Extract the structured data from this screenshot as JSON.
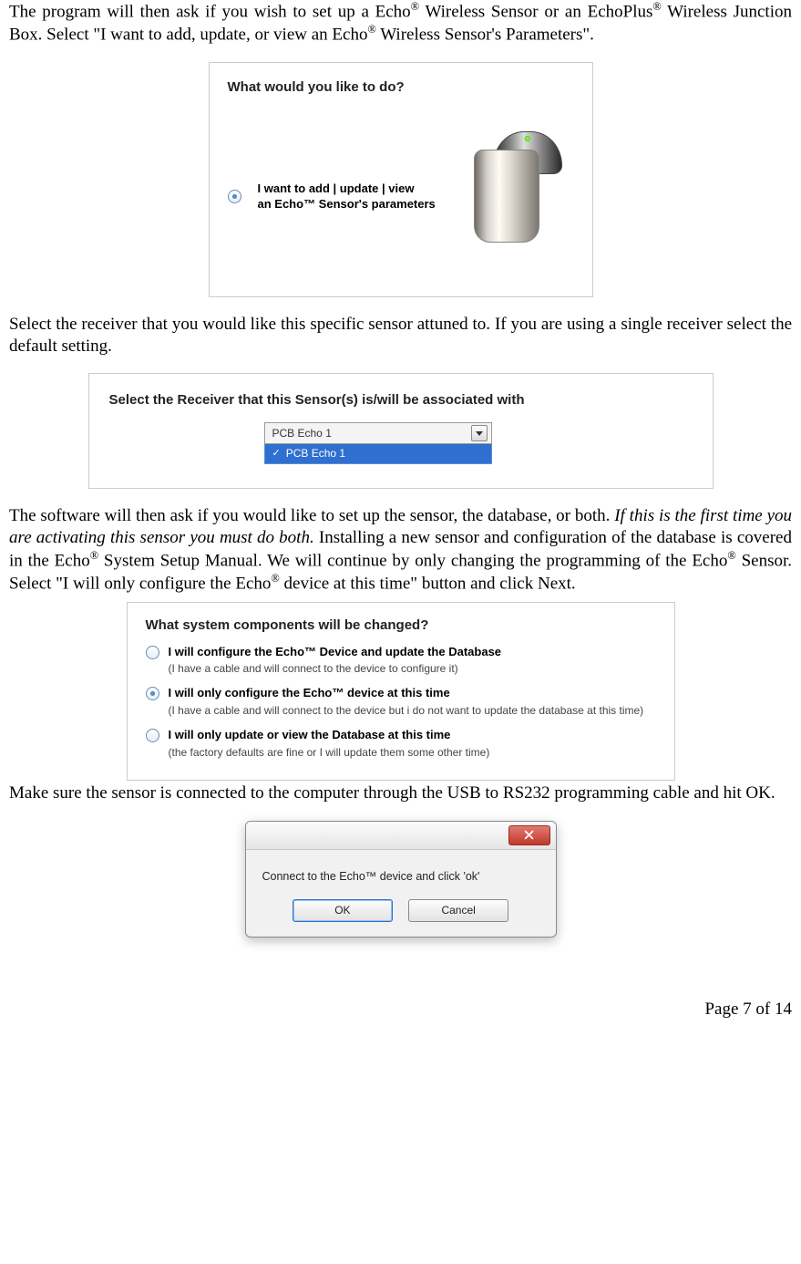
{
  "para1_a": "The program will then ask if you wish to set up a Echo",
  "para1_b": " Wireless Sensor or an EchoPlus",
  "para1_c": " Wireless Junction Box.  Select \"I want to add, update, or view an Echo",
  "para1_d": " Wireless Sensor's Parameters\".",
  "reg": "®",
  "fig1": {
    "title": "What would you like to do?",
    "opt1_line1": "I want to add | update | view",
    "opt1_line2": "an Echo™ Sensor's parameters"
  },
  "para2": "Select the receiver that you would like this specific sensor attuned to.  If you are using a single receiver select the default setting.",
  "fig2": {
    "title": "Select the Receiver that this Sensor(s) is/will be associated with",
    "selected": "PCB Echo 1",
    "option": "PCB Echo 1"
  },
  "para3_a": "The software will then ask if you would like to set up the sensor, the database, or both.  ",
  "para3_italic": "If this is the first time you are activating this sensor you must do both.",
  "para3_b": "  Installing a new sensor and configuration of the database is covered in the Echo",
  "para3_c": " System Setup Manual.  We will continue by only changing the programming of the Echo",
  "para3_d": " Sensor.  Select \"I will only configure the Echo",
  "para3_e": " device at this time\" button and click Next.",
  "fig3": {
    "title": "What system components will be changed?",
    "o1_main": "I will configure the Echo™ Device and update the Database",
    "o1_sub": "(I have a cable and will connect to the device to configure it)",
    "o2_main": "I will only configure the Echo™ device at this time",
    "o2_sub": "(I have a cable and will connect to the device but i do not want to update the database at this time)",
    "o3_main": "I will only update or view the Database at this time",
    "o3_sub": "(the factory defaults are fine or I will update them some other time)"
  },
  "para4": "Make sure the sensor is connected to the computer through the USB to RS232 programming cable and hit OK.",
  "dialog": {
    "msg": "Connect to the Echo™ device and click 'ok'",
    "ok": "OK",
    "cancel": "Cancel"
  },
  "footer": "Page 7 of 14"
}
